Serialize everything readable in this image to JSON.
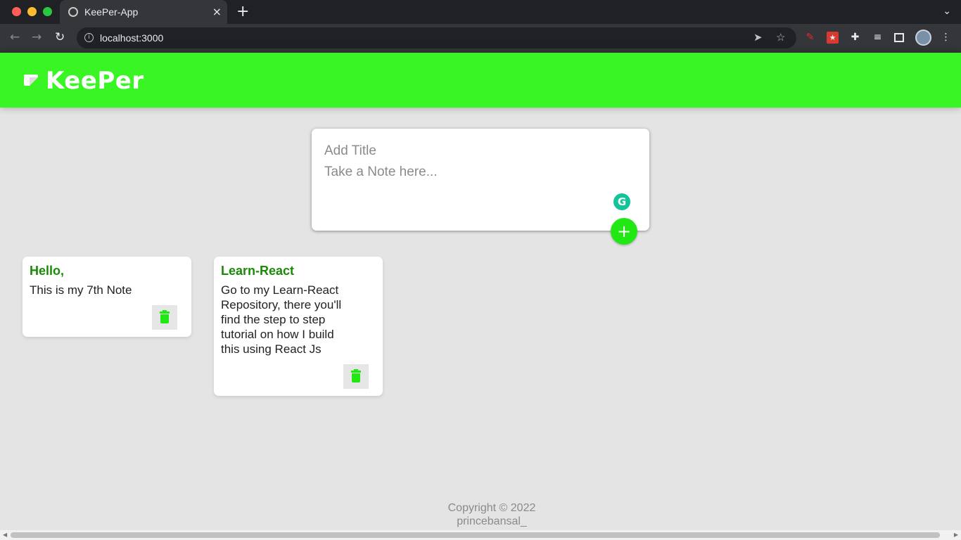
{
  "browser": {
    "tab_title": "KeePer-App",
    "tab_close": "×",
    "new_tab": "+",
    "tab_menu": "⌄",
    "url": "localhost:3000",
    "icons": [
      "back-arrow-icon",
      "forward-arrow-icon",
      "reload-icon",
      "info-icon",
      "send-icon",
      "star-icon",
      "pen-extension-icon",
      "extension-icon",
      "puzzle-icon",
      "media-icon",
      "sidebar-icon",
      "avatar",
      "more-icon"
    ]
  },
  "app": {
    "brand": "KeePer",
    "accent_color": "#39f523",
    "title_color": "#1b8a07",
    "create": {
      "title_placeholder": "Add Title",
      "content_placeholder": "Take a Note here...",
      "add_label": "+"
    },
    "notes": [
      {
        "title": "Hello,",
        "content": "This is my 7th Note"
      },
      {
        "title": "Learn-React",
        "content": "Go to my Learn-React\nRepository, there you'll\nfind the step to step\ntutorial on how I build\nthis using React Js"
      }
    ],
    "footer": {
      "line1": "Copyright © 2022",
      "line2": "princebansal_"
    }
  }
}
